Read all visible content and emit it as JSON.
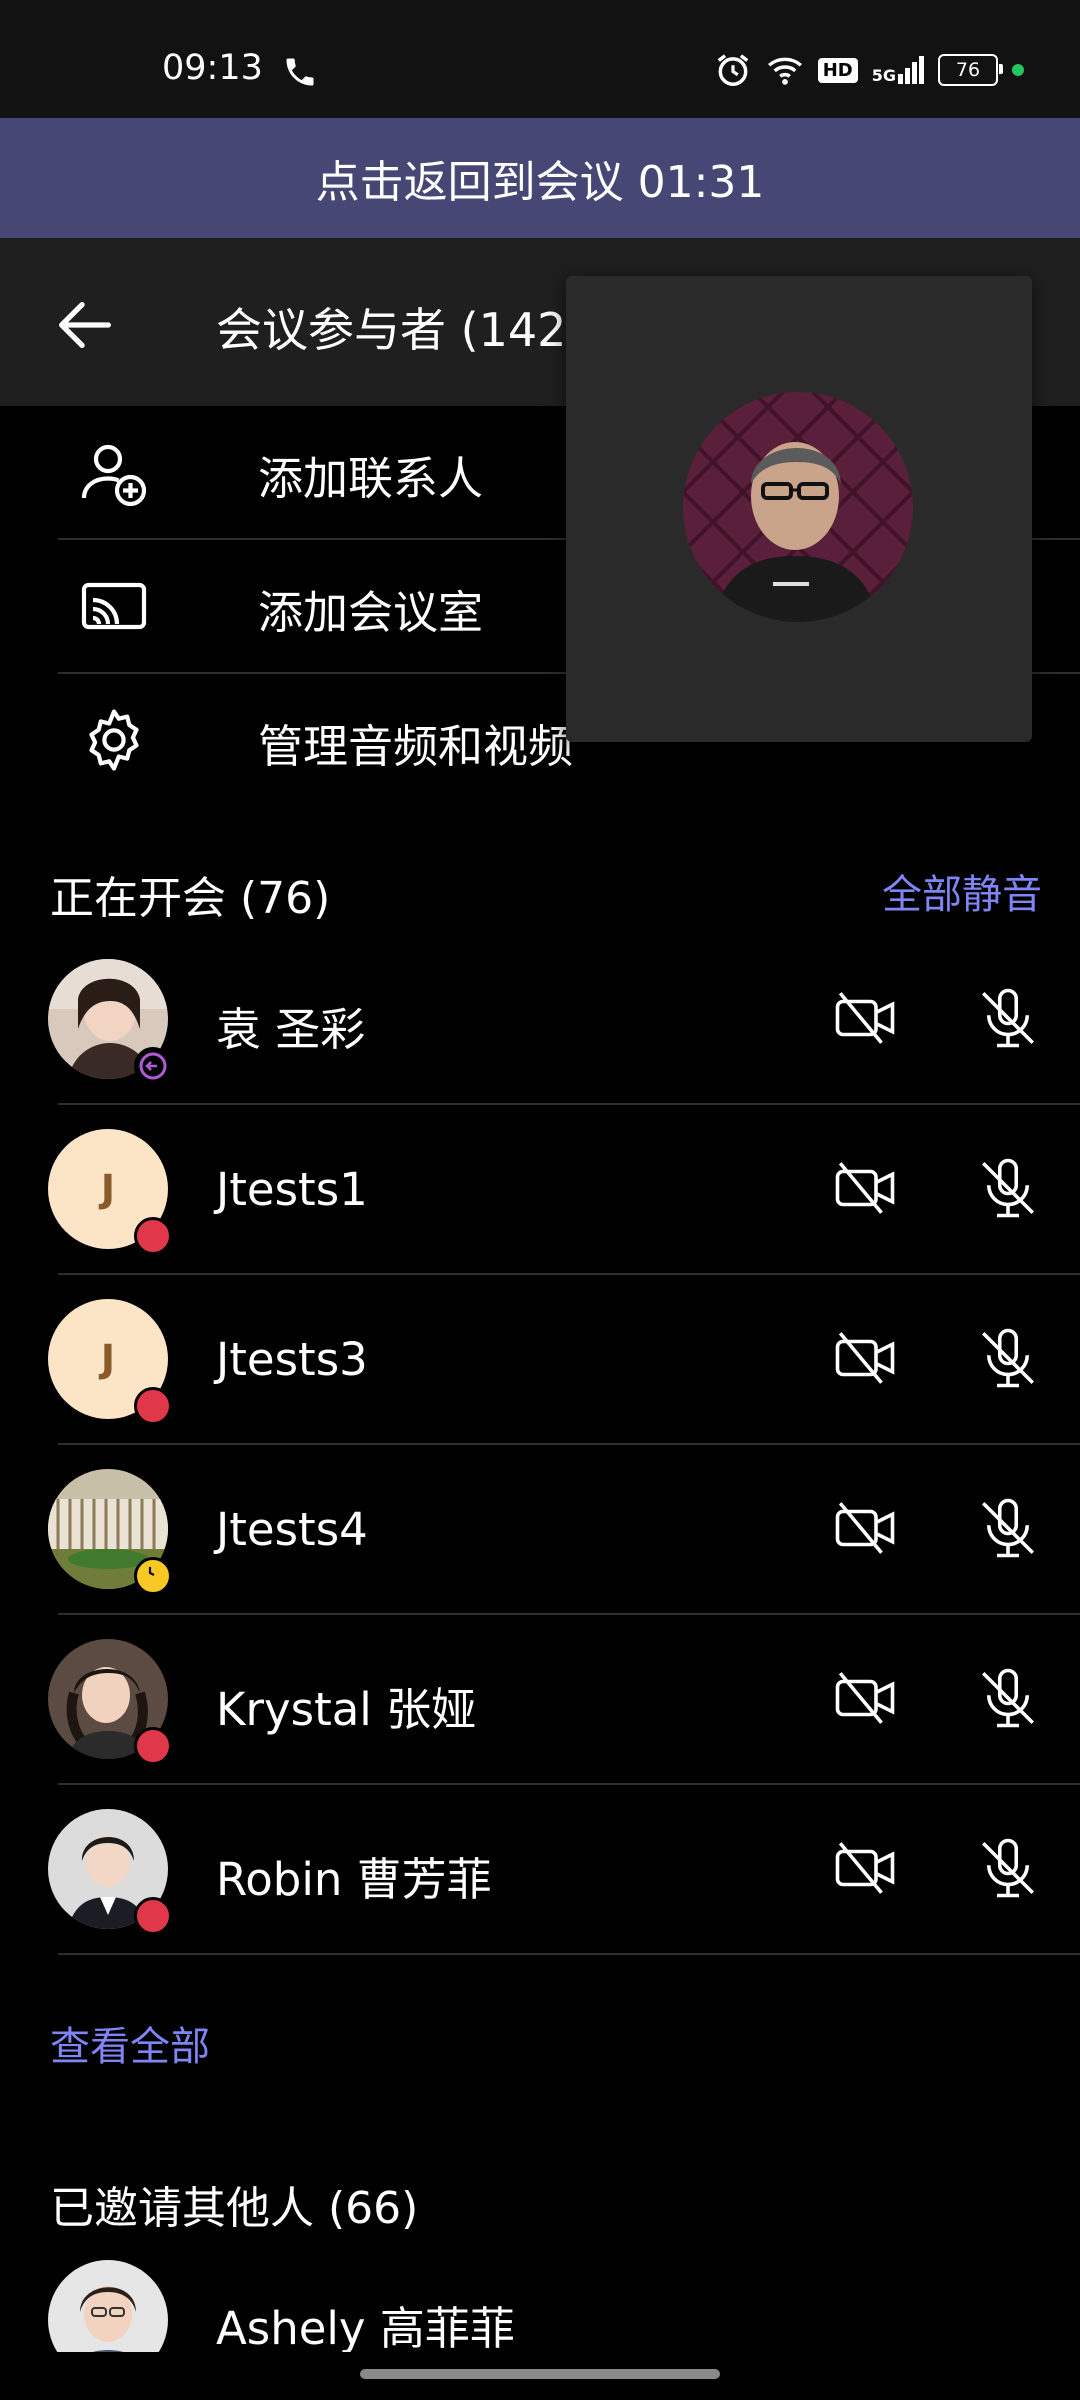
{
  "status_bar": {
    "time": "09:13",
    "phone_icon": "phone-icon",
    "alarm_icon": "alarm-icon",
    "wifi_icon": "wifi-icon",
    "hd_label": "HD",
    "network_label": "5G",
    "battery_level": "76"
  },
  "banner": {
    "label": "点击返回到会议 01:31"
  },
  "header": {
    "title": "会议参与者 (142"
  },
  "menu": [
    {
      "icon": "add-contact-icon",
      "label": "添加联系人"
    },
    {
      "icon": "cast-room-icon",
      "label": "添加会议室"
    },
    {
      "icon": "gear-icon",
      "label": "管理音频和视频"
    }
  ],
  "in_meeting": {
    "title": "正在开会 (76)",
    "mute_all_label": "全部静音",
    "participants": [
      {
        "name": "袁 圣彩",
        "presence": "out-of-office",
        "avatar": "photo"
      },
      {
        "name": "Jtests1",
        "presence": "busy",
        "avatar": "J"
      },
      {
        "name": "Jtests3",
        "presence": "busy",
        "avatar": "J"
      },
      {
        "name": "Jtests4",
        "presence": "away",
        "avatar": "photo"
      },
      {
        "name": "Krystal 张娅",
        "presence": "busy",
        "avatar": "photo"
      },
      {
        "name": "Robin 曹芳菲",
        "presence": "busy",
        "avatar": "photo"
      }
    ],
    "view_all_label": "查看全部"
  },
  "invited": {
    "title": "已邀请其他人 (66)",
    "participants": [
      {
        "name": "Ashely 高菲菲",
        "avatar": "photo"
      }
    ]
  },
  "colors": {
    "accent": "#7f85f5",
    "banner": "#464775",
    "busy": "#e0374a",
    "away": "#f8c825",
    "out_of_office": "#b05bd6"
  }
}
